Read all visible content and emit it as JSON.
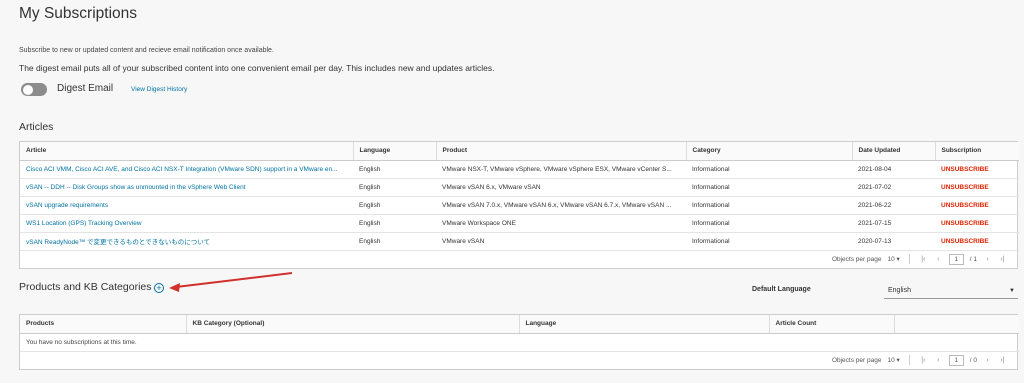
{
  "page": {
    "title": "My Subscriptions",
    "intro_small": "Subscribe to new or updated content and recieve email notification once available.",
    "intro_digest": "The digest email puts all of your subscribed content into one convenient email per day. This includes new and updates articles."
  },
  "digest": {
    "label": "Digest Email",
    "enabled": false,
    "history_link": "View Digest History"
  },
  "articles": {
    "title": "Articles",
    "columns": [
      "Article",
      "Language",
      "Product",
      "Category",
      "Date Updated",
      "Subscription"
    ],
    "rows": [
      {
        "article": "Cisco ACI VMM, Cisco ACI AVE, and Cisco ACI NSX-T Integration (VMware SDN) support in a VMware en...",
        "language": "English",
        "product": "VMware NSX-T, VMware vSphere, VMware vSphere ESX, VMware vCenter S...",
        "category": "Informational",
        "date": "2021-08-04",
        "action": "UNSUBSCRIBE"
      },
      {
        "article": "vSAN -- DDH -- Disk Groups show as unmounted in the vSphere Web Client",
        "language": "English",
        "product": "VMware vSAN 6.x, VMware vSAN",
        "category": "Informational",
        "date": "2021-07-02",
        "action": "UNSUBSCRIBE"
      },
      {
        "article": "vSAN upgrade requirements",
        "language": "English",
        "product": "VMware vSAN 7.0.x, VMware vSAN 6.x, VMware vSAN 6.7.x, VMware vSAN ...",
        "category": "Informational",
        "date": "2021-06-22",
        "action": "UNSUBSCRIBE"
      },
      {
        "article": "WS1 Location (GPS) Tracking Overview",
        "language": "English",
        "product": "VMware Workspace ONE",
        "category": "Informational",
        "date": "2021-07-15",
        "action": "UNSUBSCRIBE"
      },
      {
        "article": "vSAN ReadyNode™ で変更できるものとできないものについて",
        "language": "English",
        "product": "VMware vSAN",
        "category": "Informational",
        "date": "2020-07-13",
        "action": "UNSUBSCRIBE"
      }
    ],
    "footer": {
      "objects_per_page_label": "Objects per page",
      "per_page": "10",
      "current_page": "1",
      "total_pages": "/ 1"
    }
  },
  "products": {
    "title": "Products and KB Categories",
    "add_icon": "plus-circle-icon",
    "default_language_label": "Default Language",
    "default_language_value": "English",
    "columns": [
      "Products",
      "KB Category (Optional)",
      "Language",
      "Article Count"
    ],
    "empty_message": "You have no subscriptions at this time.",
    "footer": {
      "objects_per_page_label": "Objects per page",
      "per_page": "10",
      "current_page": "1",
      "total_pages": "/ 0"
    }
  },
  "colors": {
    "link": "#0072a3",
    "unsubscribe": "#e12200",
    "annotation_arrow": "#d0312d"
  }
}
